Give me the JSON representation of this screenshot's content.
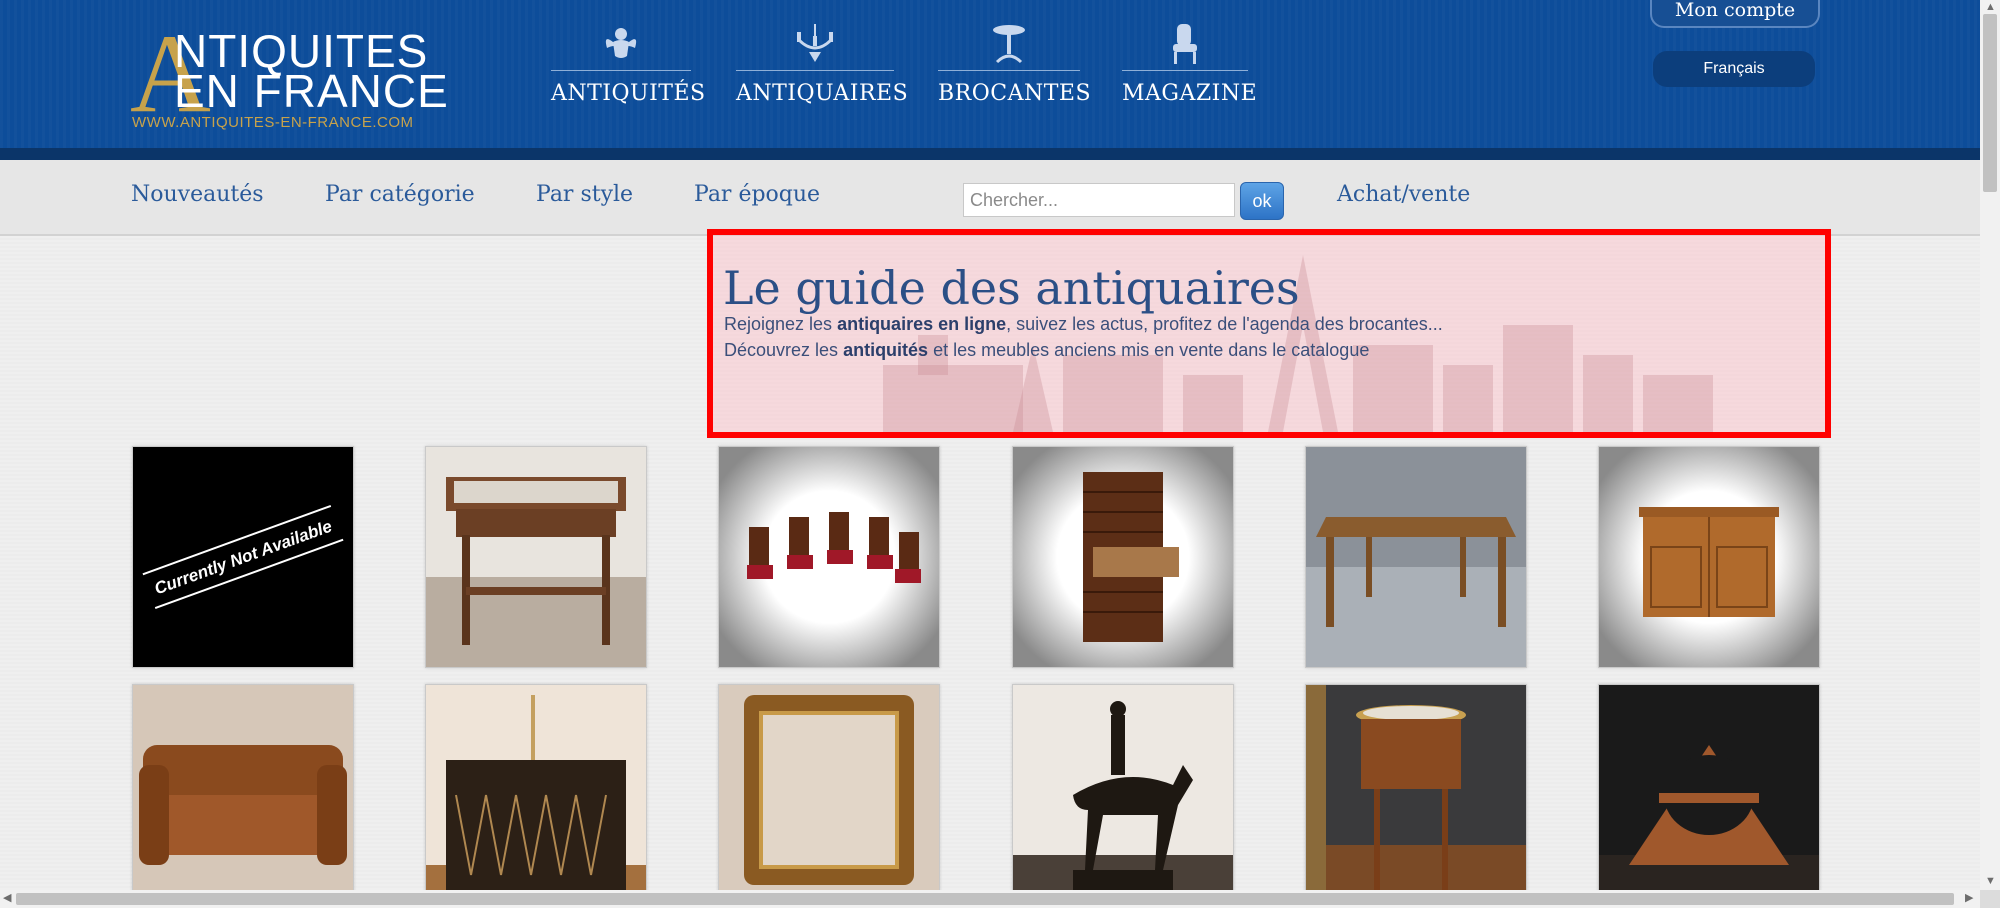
{
  "header": {
    "logo": {
      "letter": "A",
      "line1": "NTIQUITES",
      "line2": "EN FRANCE",
      "url": "WWW.ANTIQUITES-EN-FRANCE.COM"
    },
    "nav": [
      {
        "label": "ANTIQUITÉS",
        "icon": "cherub-icon"
      },
      {
        "label": "ANTIQUAIRES",
        "icon": "chandelier-icon"
      },
      {
        "label": "BROCANTES",
        "icon": "pedestal-table-icon"
      },
      {
        "label": "MAGAZINE",
        "icon": "armchair-icon"
      }
    ],
    "account_label": "Mon compte",
    "language": "Français"
  },
  "subnav": {
    "items": [
      "Nouveautés",
      "Par catégorie",
      "Par style",
      "Par époque"
    ],
    "search_placeholder": "Chercher...",
    "ok_label": "ok",
    "achat_label": "Achat/vente"
  },
  "hero": {
    "title": "Le guide des antiquaires",
    "line1": {
      "pre": "Rejoignez les ",
      "bold": "antiquaires en ligne",
      "post": ", suivez les actus, profitez de l'agenda des brocantes..."
    },
    "line2": {
      "pre": "Découvrez les ",
      "bold": "antiquités",
      "post": " et les meubles anciens mis en vente dans le catalogue"
    }
  },
  "products": {
    "placeholder_text": "Currently Not Available",
    "items": [
      {
        "name": "product-not-available"
      },
      {
        "name": "product-marble-side-table"
      },
      {
        "name": "product-red-chairs-set"
      },
      {
        "name": "product-secretary-cabinet"
      },
      {
        "name": "product-farmhouse-table"
      },
      {
        "name": "product-buffet-sideboard"
      },
      {
        "name": "product-leather-sofa"
      },
      {
        "name": "product-art-deco-cabinet"
      },
      {
        "name": "product-gilded-mirror"
      },
      {
        "name": "product-bronze-horse-rider"
      },
      {
        "name": "product-round-side-table"
      },
      {
        "name": "product-shaving-mirror-stand"
      }
    ]
  },
  "colors": {
    "header_blue": "#0d4d9a",
    "gold": "#c7a24b",
    "link_blue": "#2a5a9a",
    "highlight_red": "#ff0000"
  }
}
